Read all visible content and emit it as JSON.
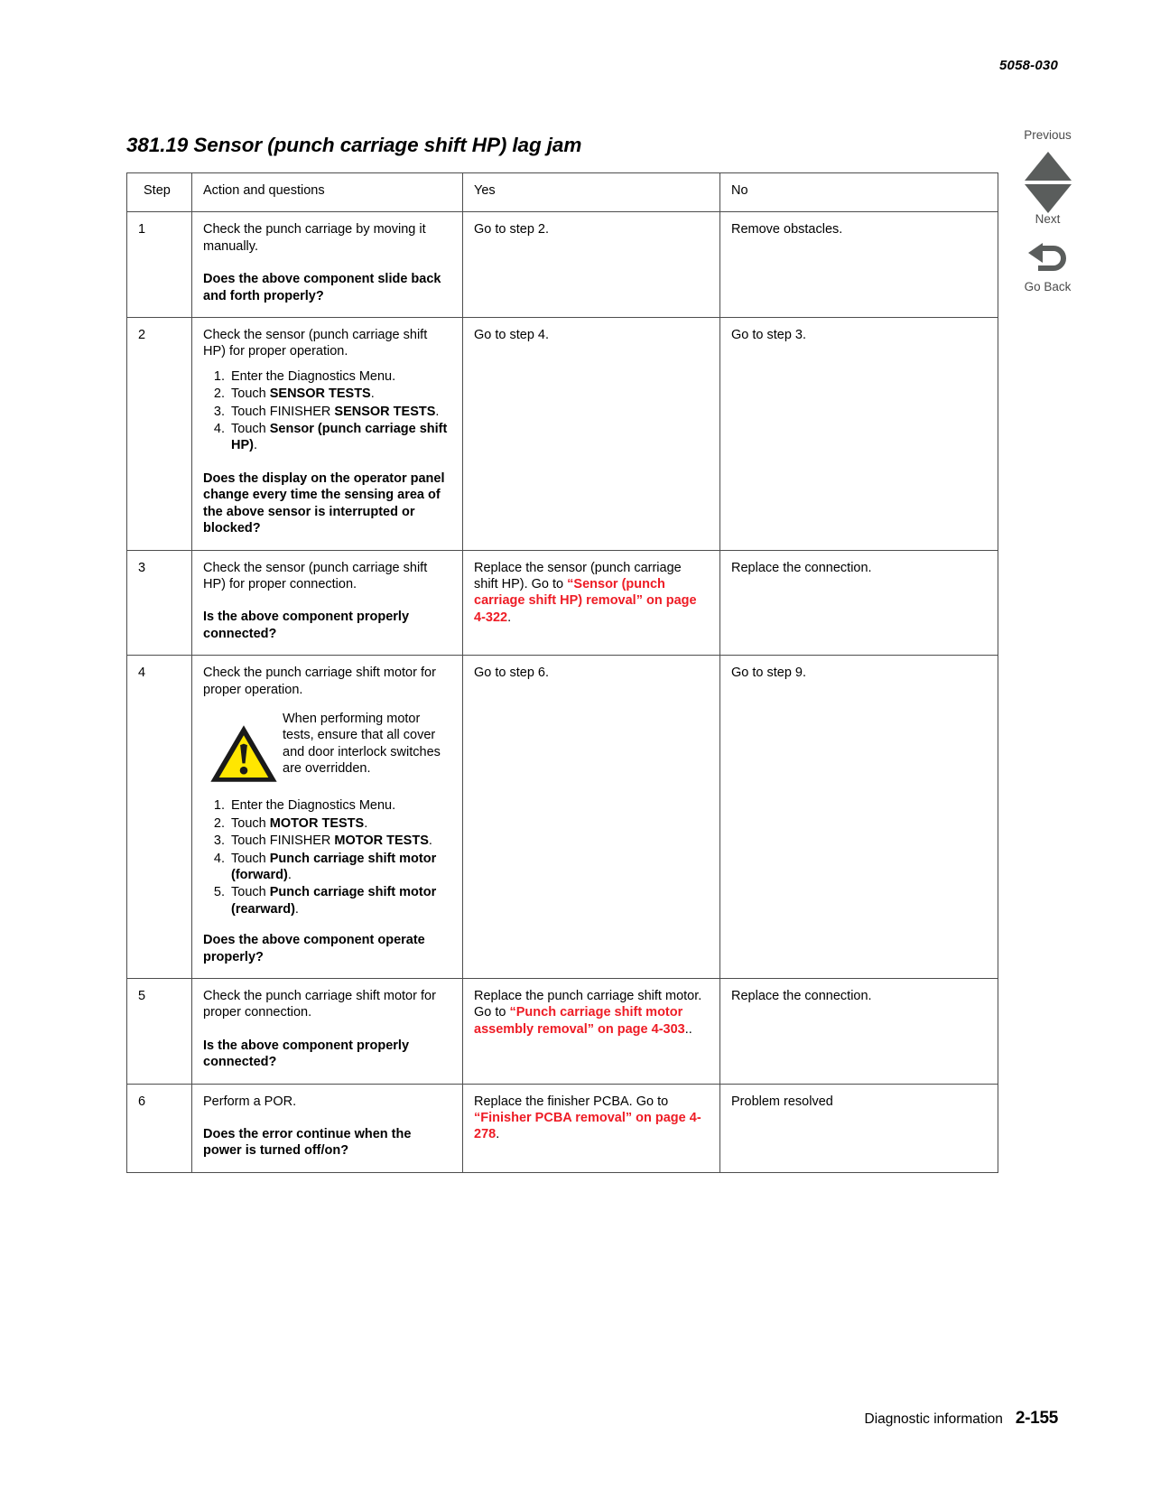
{
  "header": {
    "doc_code": "5058-030"
  },
  "section": {
    "title": "381.19 Sensor (punch carriage shift HP) lag jam"
  },
  "nav": {
    "previous_label": "Previous",
    "next_label": "Next",
    "go_back_label": "Go Back",
    "icons": {
      "up": "triangle-up-icon",
      "down": "triangle-down-icon",
      "back": "curved-back-arrow-icon"
    },
    "color": "#5a5d5c"
  },
  "table": {
    "columns": [
      "Step",
      "Action and questions",
      "Yes",
      "No"
    ],
    "rows": [
      {
        "step": "1",
        "action": {
          "intro": "Check the punch carriage by moving it manually.",
          "list": [],
          "question": "Does the above component slide back and forth properly?"
        },
        "yes": {
          "lead": "Go to step 2.",
          "link": "",
          "tail": ""
        },
        "no": "Remove obstacles."
      },
      {
        "step": "2",
        "action": {
          "intro": "Check the sensor (punch carriage shift HP) for proper operation.",
          "list": [
            "Enter the Diagnostics Menu.",
            "Touch SENSOR TESTS.",
            "Touch FINISHER SENSOR TESTS.",
            "Touch Sensor (punch carriage shift HP)."
          ],
          "question": "Does the display on the operator panel change every time the sensing area of the above sensor is interrupted or blocked?"
        },
        "yes": {
          "lead": "Go to step 4.",
          "link": "",
          "tail": ""
        },
        "no": "Go to step 3."
      },
      {
        "step": "3",
        "action": {
          "intro": "Check the sensor (punch carriage shift HP) for proper connection.",
          "list": [],
          "question": "Is the above component properly connected?"
        },
        "yes": {
          "lead": "Replace the sensor (punch carriage shift HP). Go to ",
          "link": "“Sensor (punch carriage shift HP) removal” on page 4-322",
          "tail": "."
        },
        "no": "Replace the connection."
      },
      {
        "step": "4",
        "action": {
          "intro": "Check the punch carriage shift motor for proper operation.",
          "warning": "When performing motor tests, ensure that all cover and door interlock switches are overridden.",
          "list": [
            "Enter the Diagnostics Menu.",
            "Touch MOTOR TESTS.",
            "Touch FINISHER MOTOR TESTS.",
            "Touch Punch carriage shift motor (forward).",
            "Touch Punch carriage shift motor (rearward)."
          ],
          "question": "Does the above component operate properly?"
        },
        "yes": {
          "lead": "Go to step 6.",
          "link": "",
          "tail": ""
        },
        "no": "Go to step 9."
      },
      {
        "step": "5",
        "action": {
          "intro": "Check the punch carriage shift motor for proper connection.",
          "list": [],
          "question": "Is the above component properly connected?"
        },
        "yes": {
          "lead": "Replace the punch carriage shift motor. Go to ",
          "link": "“Punch carriage shift motor assembly removal” on page 4-303",
          "tail": ".."
        },
        "no": "Replace the connection."
      },
      {
        "step": "6",
        "action": {
          "intro": "Perform a POR.",
          "list": [],
          "question": "Does the error continue when the power is turned off/on?"
        },
        "yes": {
          "lead": "Replace the finisher PCBA. Go to ",
          "link": "“Finisher PCBA removal” on page 4-278",
          "tail": "."
        },
        "no": "Problem resolved"
      }
    ]
  },
  "footer": {
    "label": "Diagnostic information",
    "page": "2-155"
  },
  "colors": {
    "link_red": "#ee1c25",
    "warn_yellow": "#ffe600",
    "nav_gray": "#5a5d5c",
    "border": "#4d4d4d"
  }
}
